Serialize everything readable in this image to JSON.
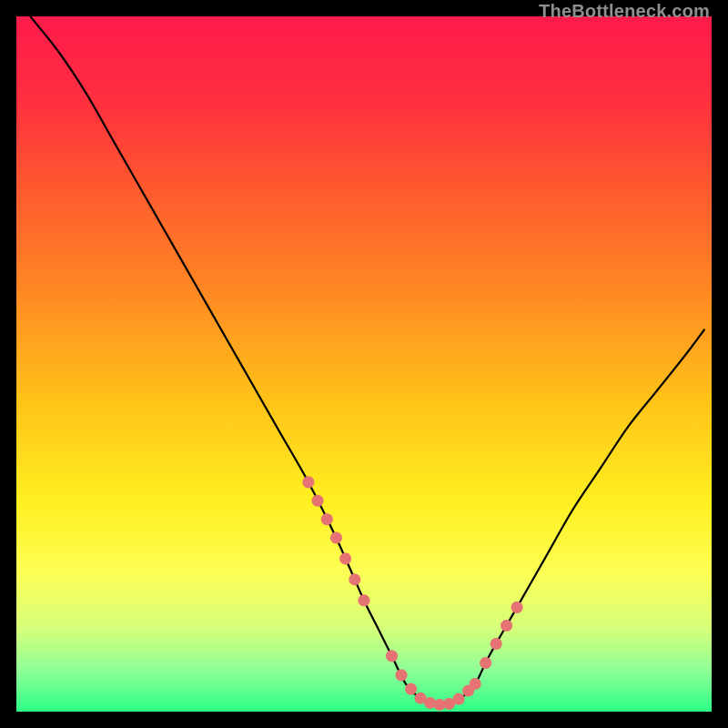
{
  "watermark": "TheBottleneck.com",
  "chart_data": {
    "type": "line",
    "title": "",
    "xlabel": "",
    "ylabel": "",
    "xlim": [
      0,
      100
    ],
    "ylim": [
      0,
      100
    ],
    "series": [
      {
        "name": "curve",
        "x": [
          2,
          6,
          10,
          14,
          18,
          22,
          26,
          30,
          34,
          38,
          42,
          46,
          50,
          52,
          54,
          56,
          58,
          60,
          62,
          64,
          66,
          68,
          72,
          76,
          80,
          84,
          88,
          92,
          96,
          99
        ],
        "values": [
          100,
          95,
          89,
          82,
          75,
          68,
          61,
          54,
          47,
          40,
          33,
          25,
          16,
          12,
          8,
          4,
          2,
          1,
          1,
          2,
          4,
          8,
          15,
          22,
          29,
          35,
          41,
          46,
          51,
          55
        ]
      }
    ],
    "highlight_sections": [
      {
        "name": "left-band",
        "x_start": 42,
        "x_end": 50
      },
      {
        "name": "floor-band",
        "x_start": 54,
        "x_end": 65
      },
      {
        "name": "right-band",
        "x_start": 66,
        "x_end": 72
      }
    ],
    "gradient": {
      "stops": [
        {
          "offset": 0.0,
          "color": "#ff1a4b"
        },
        {
          "offset": 0.12,
          "color": "#ff2f3f"
        },
        {
          "offset": 0.25,
          "color": "#ff5a2e"
        },
        {
          "offset": 0.4,
          "color": "#ff8a22"
        },
        {
          "offset": 0.55,
          "color": "#ffc218"
        },
        {
          "offset": 0.7,
          "color": "#fff020"
        },
        {
          "offset": 0.8,
          "color": "#fdff55"
        },
        {
          "offset": 0.88,
          "color": "#d6ff7a"
        },
        {
          "offset": 0.94,
          "color": "#8fff96"
        },
        {
          "offset": 1.0,
          "color": "#2cff86"
        }
      ]
    },
    "marker_color": "#e57373",
    "curve_color": "#000000"
  }
}
